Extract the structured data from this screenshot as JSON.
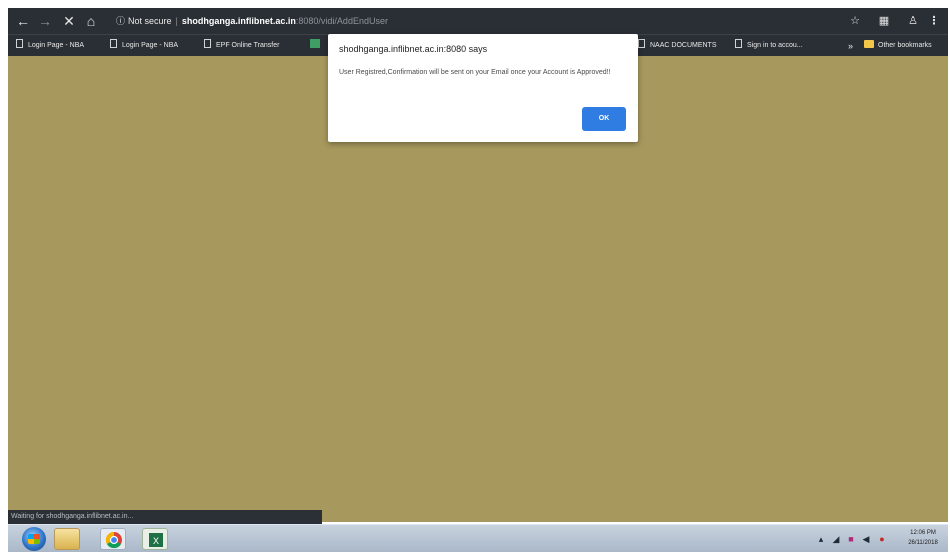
{
  "browser": {
    "security_label": "Not secure",
    "host": "shodhganga.inflibnet.ac.in",
    "path": ":8080/vidi/AddEndUser",
    "icons": [
      "back-arrow-icon",
      "forward-arrow-icon",
      "stop-icon",
      "home-icon",
      "info-icon",
      "star-icon",
      "extension-icon",
      "profile-icon",
      "menu-icon"
    ]
  },
  "bookmarks": {
    "items": [
      {
        "label": "Login Page - NBA"
      },
      {
        "label": "Login Page - NBA"
      },
      {
        "label": "EPF Online Transfer"
      }
    ],
    "right_items": [
      {
        "label": "NAAC DOCUMENTS"
      },
      {
        "label": "Sign in to accou..."
      }
    ],
    "overflow_label": "»",
    "other_label": "Other bookmarks"
  },
  "dialog": {
    "title": "shodhganga.inflibnet.ac.in:8080 says",
    "message": "User Registred,Confirmation will be sent on your Email once your Account is Approved!!",
    "ok_label": "OK"
  },
  "status_bar": {
    "text": "Waiting for shodhganga.inflibnet.ac.in..."
  },
  "taskbar": {
    "apps": [
      "explorer-icon",
      "chrome-icon",
      "excel-icon"
    ],
    "time": "12:06 PM",
    "date": "26/11/2018"
  },
  "colors": {
    "page_background": "#a7995d",
    "chrome_dark": "#2a2f35",
    "ok_button": "#2f7ce2"
  }
}
